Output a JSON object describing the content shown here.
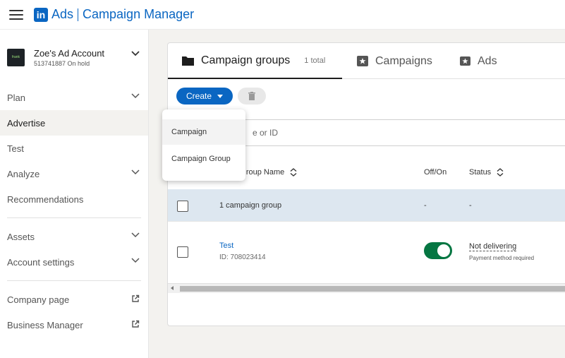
{
  "header": {
    "logo_text": "in",
    "brand_ads": "Ads",
    "brand_name": "Campaign Manager"
  },
  "account": {
    "logo_text": "frank",
    "name": "Zoe's Ad Account",
    "sub": "513741887 On hold"
  },
  "sidebar": {
    "items": [
      {
        "label": "Plan"
      },
      {
        "label": "Advertise"
      },
      {
        "label": "Test"
      },
      {
        "label": "Analyze"
      },
      {
        "label": "Recommendations"
      },
      {
        "label": "Assets"
      },
      {
        "label": "Account settings"
      },
      {
        "label": "Company page"
      },
      {
        "label": "Business Manager"
      }
    ]
  },
  "tabs": [
    {
      "label": "Campaign groups",
      "count": "1 total"
    },
    {
      "label": "Campaigns"
    },
    {
      "label": "Ads"
    }
  ],
  "toolbar": {
    "create_label": "Create"
  },
  "search": {
    "placeholder": "e or ID"
  },
  "table": {
    "columns": [
      "gn Group Name",
      "Off/On",
      "Status"
    ],
    "summary": {
      "name": "1 campaign group",
      "off_on": "-",
      "status": "-"
    },
    "rows": [
      {
        "name": "Test",
        "id": "ID: 708023414",
        "status": "Not delivering",
        "status_sub": "Payment method required"
      }
    ]
  },
  "dropdown": {
    "items": [
      "Campaign",
      "Campaign Group"
    ]
  },
  "colors": {
    "brand": "#0a66c2",
    "toggle_on": "#057642",
    "summary_bg": "#dde7f0"
  }
}
